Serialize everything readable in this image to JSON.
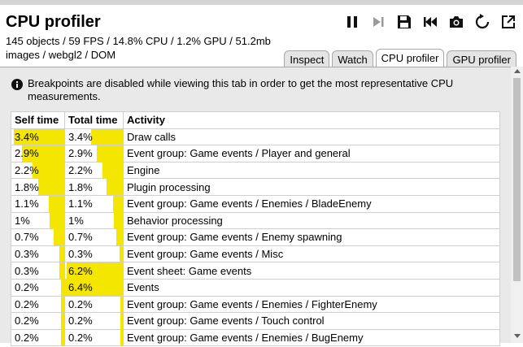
{
  "title": "CPU profiler",
  "stats": {
    "line1": "145 objects / 59 FPS / 14.8% CPU / 1.2% GPU / 51.2mb",
    "line2": "images / webgl2 / DOM"
  },
  "toolbar": {
    "icons": [
      "pause-icon",
      "step-icon",
      "save-icon",
      "restart-icon",
      "camera-icon",
      "reload-icon",
      "popout-icon"
    ]
  },
  "tabs": [
    {
      "label": "Inspect",
      "active": false
    },
    {
      "label": "Watch",
      "active": false
    },
    {
      "label": "CPU profiler",
      "active": true
    },
    {
      "label": "GPU profiler",
      "active": false
    }
  ],
  "notice": "Breakpoints are disabled while viewing this tab in order to get the most representative CPU measurements.",
  "table": {
    "headers": [
      "Self time",
      "Total time",
      "Activity"
    ],
    "bar_color": "#f5e600",
    "rows": [
      {
        "self": "3.4%",
        "total": "3.4%",
        "activity": "Draw calls",
        "self_frac": 0.95,
        "total_frac": 0.55
      },
      {
        "self": "2.9%",
        "total": "2.9%",
        "activity": "Event group: Game events / Player and general",
        "self_frac": 0.8,
        "total_frac": 0.45
      },
      {
        "self": "2.2%",
        "total": "2.2%",
        "activity": "Engine",
        "self_frac": 0.6,
        "total_frac": 0.35
      },
      {
        "self": "1.8%",
        "total": "1.8%",
        "activity": "Plugin processing",
        "self_frac": 0.5,
        "total_frac": 0.28
      },
      {
        "self": "1.1%",
        "total": "1.1%",
        "activity": "Event group: Game events / Enemies / BladeEnemy",
        "self_frac": 0.3,
        "total_frac": 0.17
      },
      {
        "self": "1%",
        "total": "1%",
        "activity": "Behavior processing",
        "self_frac": 0.28,
        "total_frac": 0.16
      },
      {
        "self": "0.7%",
        "total": "0.7%",
        "activity": "Event group: Game events / Enemy spawning",
        "self_frac": 0.2,
        "total_frac": 0.11
      },
      {
        "self": "0.3%",
        "total": "0.3%",
        "activity": "Event group: Game events / Misc",
        "self_frac": 0.09,
        "total_frac": 0.05
      },
      {
        "self": "0.3%",
        "total": "6.2%",
        "activity": "Event sheet: Game events",
        "self_frac": 0.09,
        "total_frac": 0.97
      },
      {
        "self": "0.2%",
        "total": "6.4%",
        "activity": "Events",
        "self_frac": 0.06,
        "total_frac": 1.0
      },
      {
        "self": "0.2%",
        "total": "0.2%",
        "activity": "Event group: Game events / Enemies / FighterEnemy",
        "self_frac": 0.06,
        "total_frac": 0.04
      },
      {
        "self": "0.2%",
        "total": "0.2%",
        "activity": "Event group: Game events / Touch control",
        "self_frac": 0.06,
        "total_frac": 0.04
      },
      {
        "self": "0.2%",
        "total": "0.2%",
        "activity": "Event group: Game events / Enemies / BugEnemy",
        "self_frac": 0.06,
        "total_frac": 0.04
      }
    ]
  }
}
